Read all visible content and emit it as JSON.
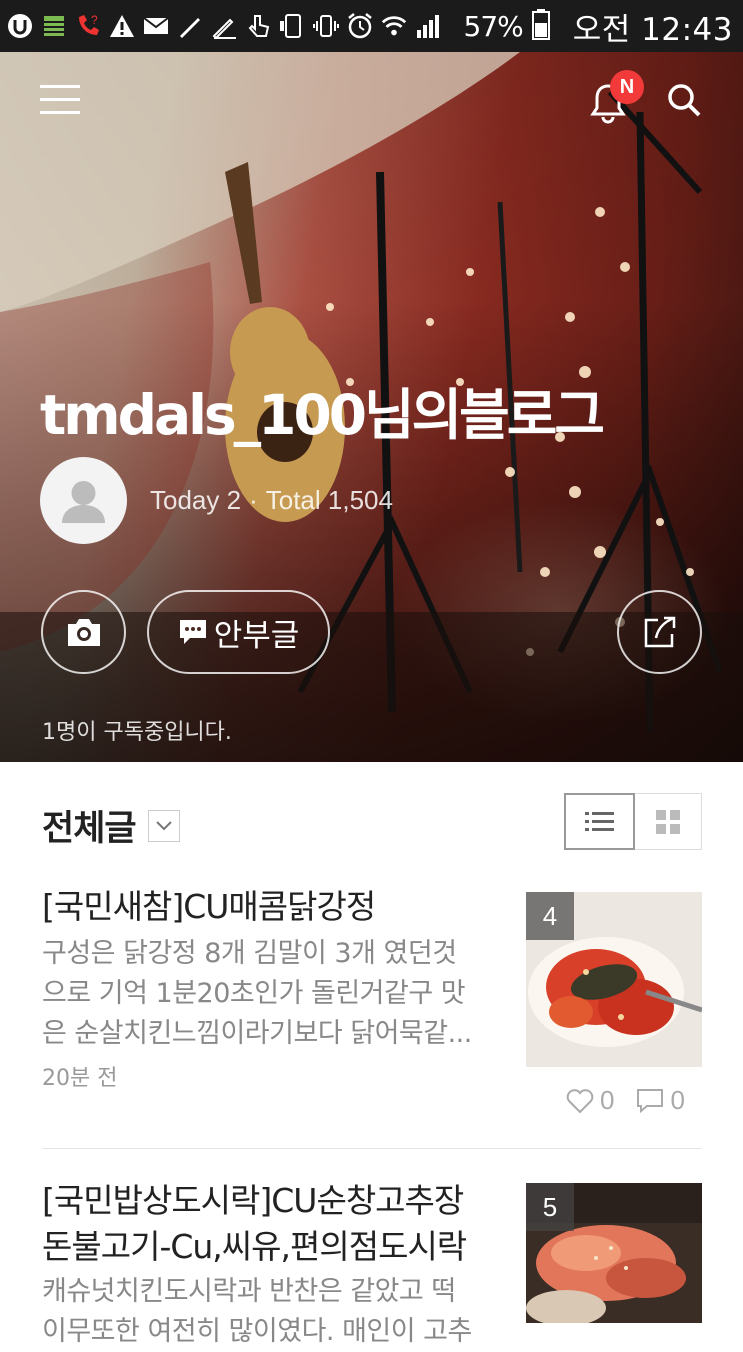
{
  "status_bar": {
    "battery_percent": "57%",
    "time": "오전 12:43",
    "icons": [
      "u-plus-icon",
      "storage-icon",
      "missed-call-icon",
      "warning-icon",
      "mail-icon",
      "pen-icon",
      "pen-icon",
      "touch-icon",
      "phone-icon",
      "vibrate-icon",
      "alarm-icon",
      "wifi-icon",
      "signal-icon",
      "battery-icon"
    ]
  },
  "header": {
    "notification_badge": "N",
    "blog_title": "tmdals_100님의블로그",
    "today_label": "Today 2",
    "separator": "·",
    "total_label": "Total 1,504",
    "guestbook_label": "안부글",
    "subscribers": "1명이 구독중입니다."
  },
  "list_header": {
    "title": "전체글"
  },
  "posts": [
    {
      "title": "[국민새참]CU매콤닭강정",
      "excerpt_lines": [
        "구성은 닭강정 8개 김말이 3개 였던것",
        "으로 기억 1분20초인가 돌린거같구 맛",
        "은 순살치킨느낌이라기보다 닭어묵같..."
      ],
      "time": "20분 전",
      "photo_count": "4",
      "likes": "0",
      "comments": "0"
    },
    {
      "title_lines": [
        "[국민밥상도시락]CU순창고추장",
        "돈불고기-Cu,씨유,편의점도시락"
      ],
      "excerpt_lines": [
        "캐슈넛치킨도시락과 반찬은 같았고 떡",
        "이무또한 여전히 많이였다. 매인이 고추"
      ],
      "photo_count": "5"
    }
  ],
  "colors": {
    "accent_badge": "#f33a3a",
    "title_text": "#222222",
    "muted_text": "#888888"
  }
}
